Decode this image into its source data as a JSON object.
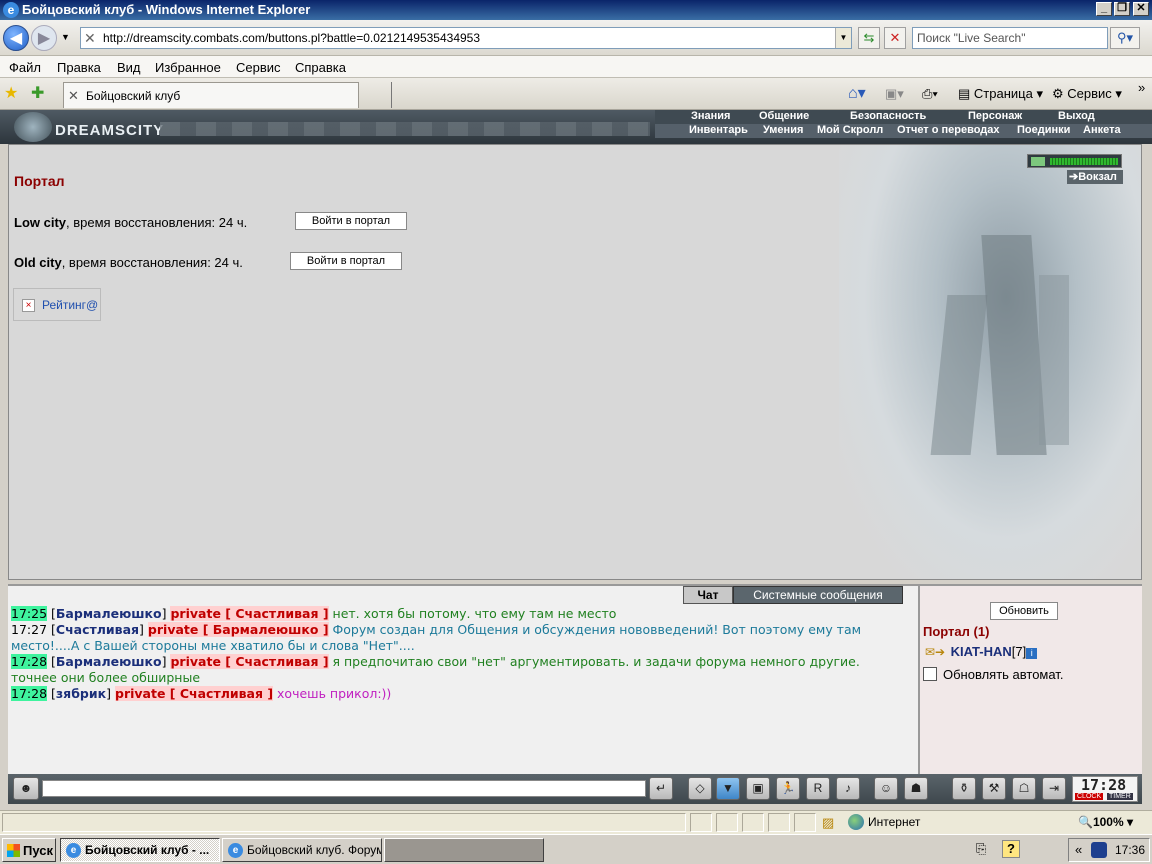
{
  "window": {
    "title": "Бойцовский клуб - Windows Internet Explorer"
  },
  "address": {
    "url": "http://dreamscity.combats.com/buttons.pl?battle=0.0212149535434953",
    "search_placeholder": "Поиск \"Live Search\""
  },
  "menu": [
    "Файл",
    "Правка",
    "Вид",
    "Избранное",
    "Сервис",
    "Справка"
  ],
  "tab": {
    "label": "Бойцовский клуб"
  },
  "toolbar": {
    "page": "Страница",
    "service": "Сервис"
  },
  "game": {
    "logo": "DREAMSCITY",
    "top_links": [
      "Знания",
      "Общение",
      "Безопасность",
      "Персонаж",
      "Выход"
    ],
    "sub_links": [
      "Инвентарь",
      "Умения",
      "Мой Скролл",
      "Отчет о переводах",
      "Поединки",
      "Анкета"
    ],
    "vokzal": "Вокзал"
  },
  "portal": {
    "heading": "Портал",
    "cities": [
      {
        "name": "Low city",
        "text": ", время восстановления: 24 ч.",
        "button": "Войти в портал"
      },
      {
        "name": "Old city",
        "text": ", время восстановления: 24 ч.",
        "button": "Войти в портал"
      }
    ],
    "rating": "Рейтинг@"
  },
  "chat": {
    "tabs": {
      "chat": "Чат",
      "system": "Системные сообщения"
    },
    "messages": [
      {
        "time": "17:25",
        "highlight": true,
        "from": "Бармалеюшко",
        "to": "private [ Счастливая ]",
        "text": "нет. хотя бы потому. что ему там не место",
        "color": "#208020"
      },
      {
        "time": "17:27",
        "highlight": false,
        "from": "Счастливая",
        "to": "private [ Бармалеюшко ]",
        "text": "Форум создан для Общения и обсуждения нововведений! Вот поэтому ему там место!....А с Вашей стороны мне хватило бы и слова \"Нет\"....",
        "color": "#1c7a9a"
      },
      {
        "time": "17:28",
        "highlight": true,
        "from": "Бармалеюшко",
        "to": "private [ Счастливая ]",
        "text": "я предпочитаю свои \"нет\" аргументировать. и задачи форума немного другие. точнее они более обширные",
        "color": "#208020"
      },
      {
        "time": "17:28",
        "highlight": true,
        "from": "зябрик",
        "to": "private [ Счастливая ]",
        "text": "хочешь прикол:))",
        "color": "#c020c0"
      }
    ]
  },
  "online": {
    "refresh": "Обновить",
    "location": "Портал (1)",
    "user_name": "KIAT-HAN",
    "user_level": "[7]",
    "auto_refresh": "Обновлять автомат."
  },
  "gamebar": {
    "clock": "17:28",
    "clock_label": "CLOCK",
    "timer_label": "TIMER"
  },
  "status": {
    "zone": "Интернет",
    "zoom": "100%"
  },
  "taskbar": {
    "start": "Пуск",
    "tasks": [
      "Бойцовский клуб - ...",
      "Бойцовский клуб. Форум"
    ],
    "time": "17:36"
  }
}
